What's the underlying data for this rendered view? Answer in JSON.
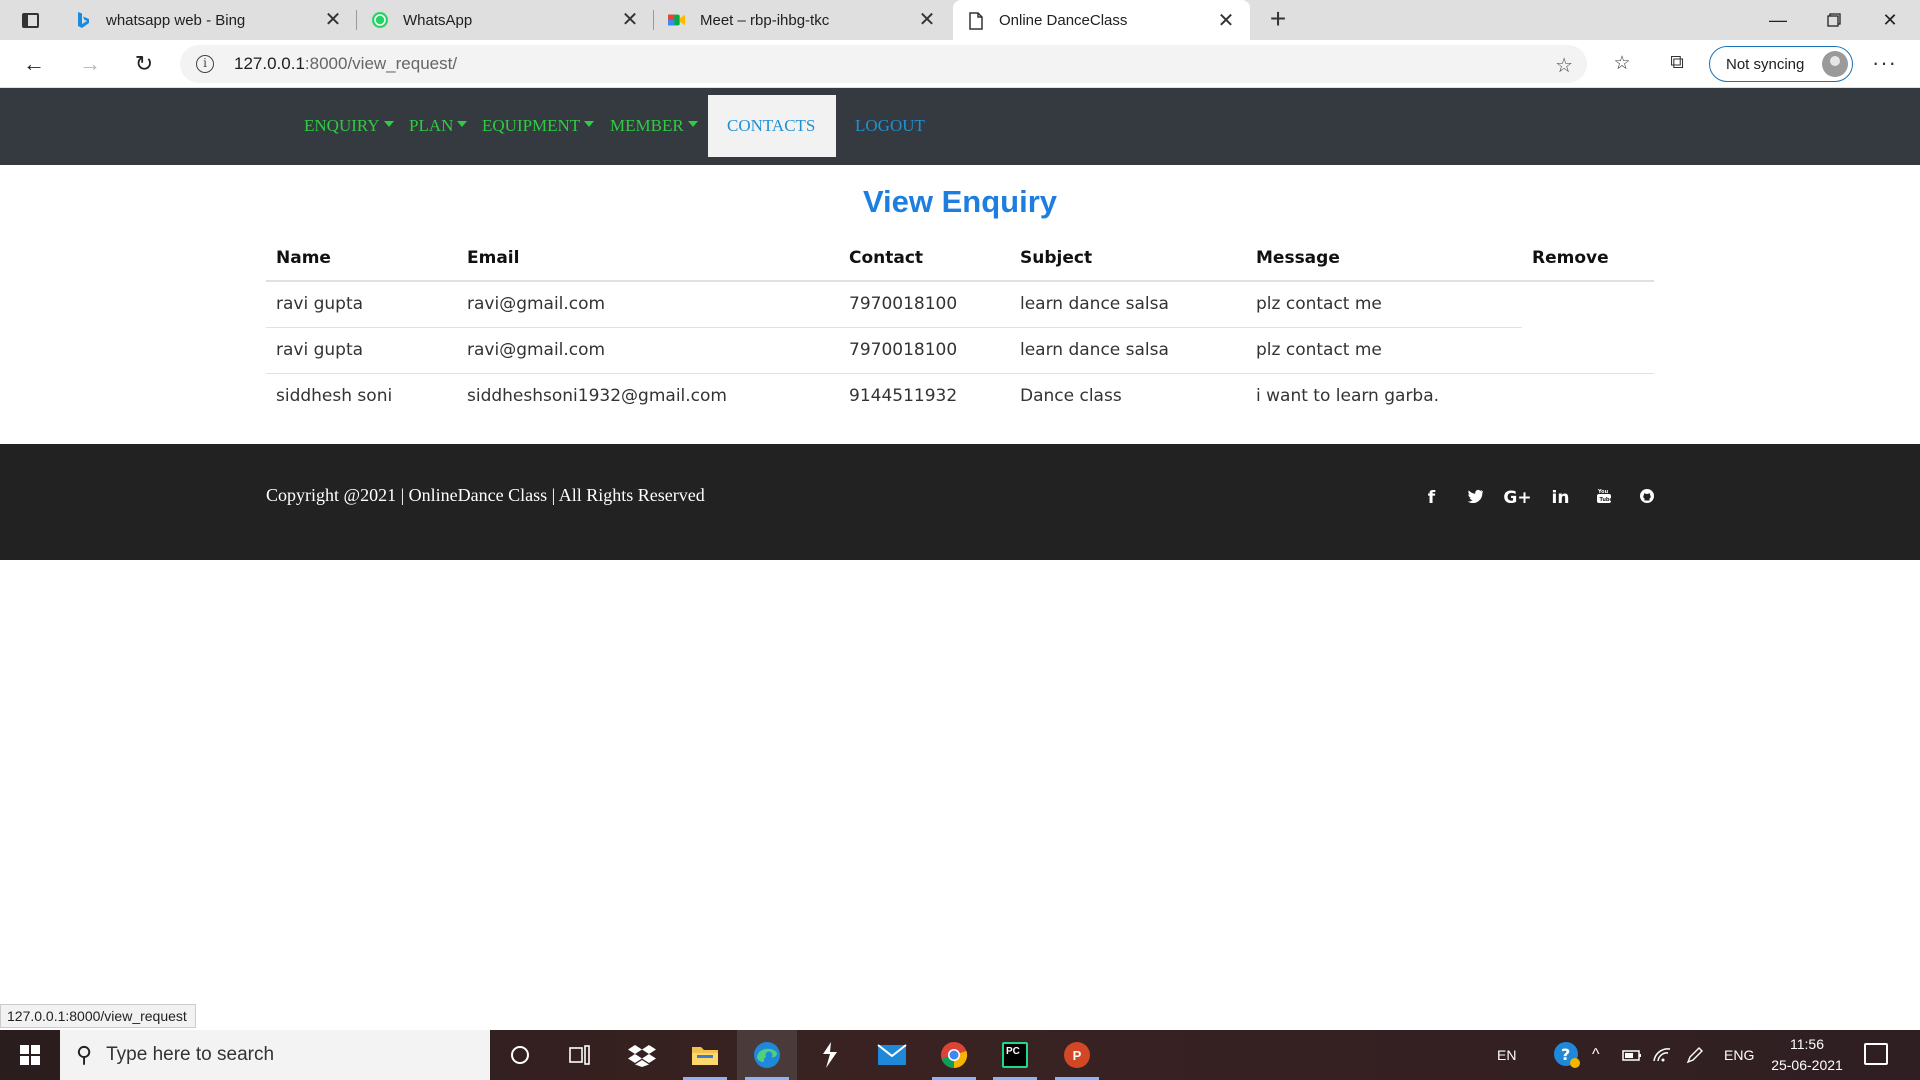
{
  "browser": {
    "tabs": [
      {
        "title": "whatsapp web - Bing",
        "icon": "bing-icon",
        "active": false
      },
      {
        "title": "WhatsApp",
        "icon": "whatsapp-icon",
        "active": false
      },
      {
        "title": "Meet – rbp-ihbg-tkc",
        "icon": "meet-icon",
        "active": false
      },
      {
        "title": "Online DanceClass",
        "icon": "page-icon",
        "active": true
      }
    ],
    "url_host": "127.0.0.1",
    "url_path": ":8000/view_request/",
    "sync_label": "Not syncing"
  },
  "navbar": {
    "items": [
      {
        "label": "ENQUIRY",
        "dropdown": true
      },
      {
        "label": "PLAN",
        "dropdown": true
      },
      {
        "label": "EQUIPMENT",
        "dropdown": true
      },
      {
        "label": "MEMBER",
        "dropdown": true
      },
      {
        "label": "CONTACTS",
        "active": true
      },
      {
        "label": "LOGOUT"
      }
    ],
    "colors": {
      "link": "#2ecc40",
      "active": "#1e90d6",
      "background": "#343a40"
    }
  },
  "page": {
    "title": "View Enquiry"
  },
  "table": {
    "headers": [
      "Name",
      "Email",
      "Contact",
      "Subject",
      "Message",
      "Remove"
    ],
    "rows": [
      [
        "ravi gupta",
        "ravi@gmail.com",
        "7970018100",
        "learn dance salsa",
        "plz contact me"
      ],
      [
        "ravi gupta",
        "ravi@gmail.com",
        "7970018100",
        "learn dance salsa",
        "plz contact me"
      ],
      [
        "siddhesh soni",
        "siddheshsoni1932@gmail.com",
        "9144511932",
        "Dance class",
        "i want to learn garba."
      ]
    ]
  },
  "footer": {
    "copyright": "Copyright @2021 | OnlineDance Class | All Rights Reserved",
    "social": [
      {
        "icon": "facebook-icon",
        "glyph": "f"
      },
      {
        "icon": "twitter-icon",
        "glyph": "🐦"
      },
      {
        "icon": "google-plus-icon",
        "glyph": "G+"
      },
      {
        "icon": "linkedin-icon",
        "glyph": "in"
      },
      {
        "icon": "youtube-icon",
        "glyph": "▶"
      },
      {
        "icon": "github-icon",
        "glyph": "●"
      }
    ]
  },
  "status_link": "127.0.0.1:8000/view_request",
  "taskbar": {
    "search_placeholder": "Type here to search",
    "lang": "EN",
    "lang2": "ENG",
    "time": "11:56",
    "date": "25-06-2021"
  }
}
